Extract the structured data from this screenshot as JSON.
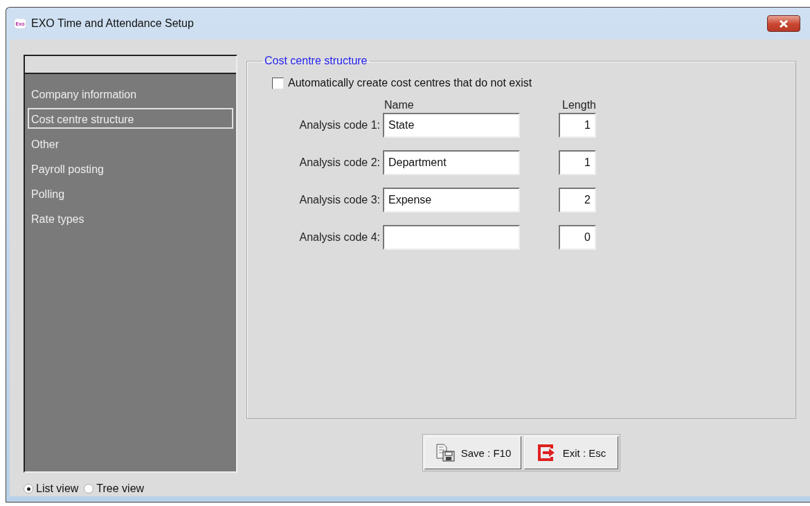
{
  "window": {
    "app_icon_text": "Exo",
    "title": "EXO Time and Attendance Setup"
  },
  "sidebar": {
    "items": [
      {
        "label": "Company information",
        "selected": false
      },
      {
        "label": "Cost centre structure",
        "selected": true
      },
      {
        "label": "Other",
        "selected": false
      },
      {
        "label": "Payroll posting",
        "selected": false
      },
      {
        "label": "Polling",
        "selected": false
      },
      {
        "label": "Rate types",
        "selected": false
      }
    ]
  },
  "view_options": [
    {
      "label": "List view",
      "selected": true
    },
    {
      "label": "Tree view",
      "selected": false
    }
  ],
  "group": {
    "title": "Cost centre structure",
    "auto_create": {
      "label": "Automatically create cost centres that do not exist",
      "checked": false
    },
    "columns": [
      "Name",
      "Length"
    ],
    "rows": [
      {
        "label": "Analysis code 1:",
        "name": "State",
        "length": "1"
      },
      {
        "label": "Analysis code 2:",
        "name": "Department",
        "length": "1"
      },
      {
        "label": "Analysis code 3:",
        "name": "Expense",
        "length": "2"
      },
      {
        "label": "Analysis code 4:",
        "length": "0"
      }
    ]
  },
  "buttons": [
    {
      "kind": "save",
      "label": "Save : F10"
    },
    {
      "kind": "exit",
      "label": "Exit : Esc"
    }
  ]
}
